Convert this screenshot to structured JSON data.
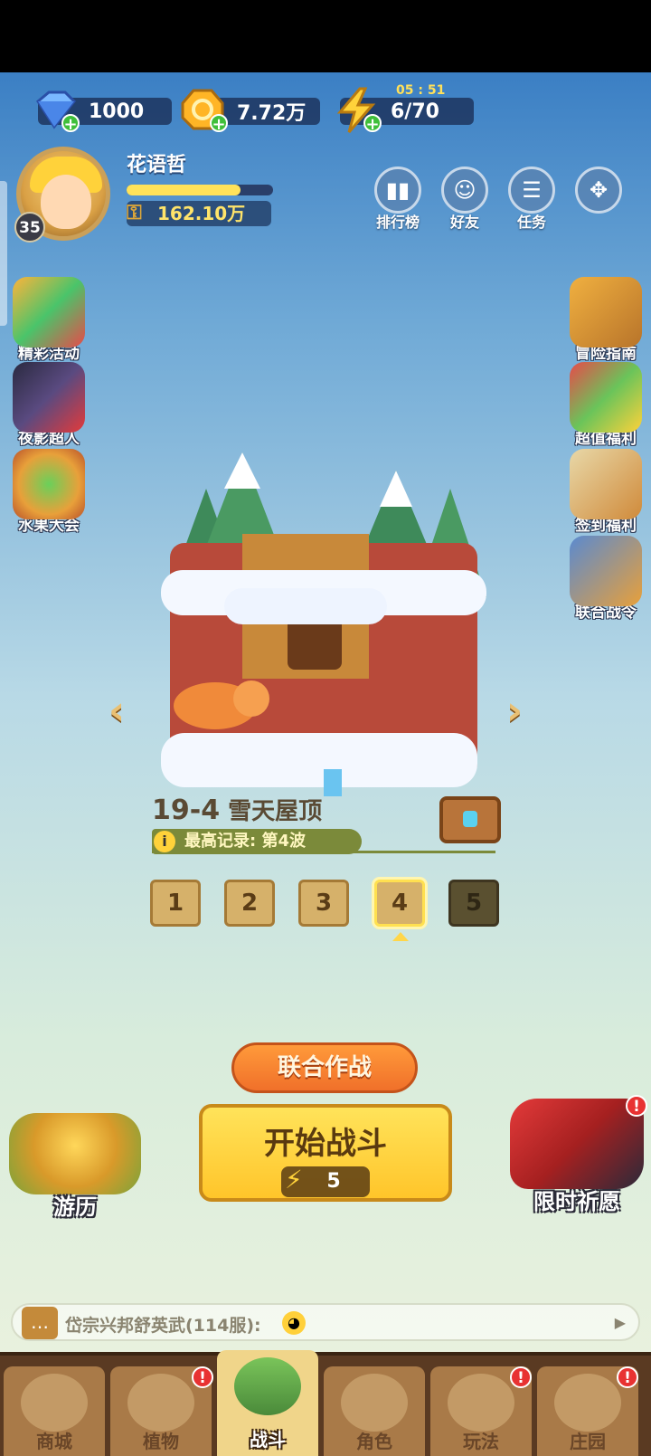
{
  "resources": {
    "diamond": "1000",
    "gold": "7.72万",
    "energy": "6/70",
    "energy_timer": "05 : 51"
  },
  "player": {
    "name": "花语哲",
    "level": "35",
    "power": "162.10万",
    "exp_fraction": 0.78
  },
  "top_menu": [
    "排行榜",
    "好友",
    "任务"
  ],
  "left_side": [
    "精彩活动",
    "夜影超人",
    "水果大会"
  ],
  "right_side": [
    "冒险指南",
    "超值福利",
    "签到福利",
    "联合战令"
  ],
  "stage": {
    "number": "19-4",
    "name": "雪天屋顶",
    "record": "最高记录: 第4波",
    "waves": [
      "1",
      "2",
      "3",
      "4",
      "5"
    ],
    "active_wave": "4"
  },
  "buttons": {
    "coop": "联合作战",
    "start": "开始战斗",
    "start_cost": "5",
    "travel": "游历",
    "wish": "限时祈愿"
  },
  "chat": {
    "text": "岱宗兴邦舒英武(114服):"
  },
  "nav": {
    "items": [
      "商城",
      "植物",
      "战斗",
      "角色",
      "玩法",
      "庄园"
    ],
    "active": "战斗"
  },
  "colors": {
    "accent_yellow": "#ffd23a",
    "button_orange": "#f0702a",
    "badge_red": "#e83232"
  }
}
